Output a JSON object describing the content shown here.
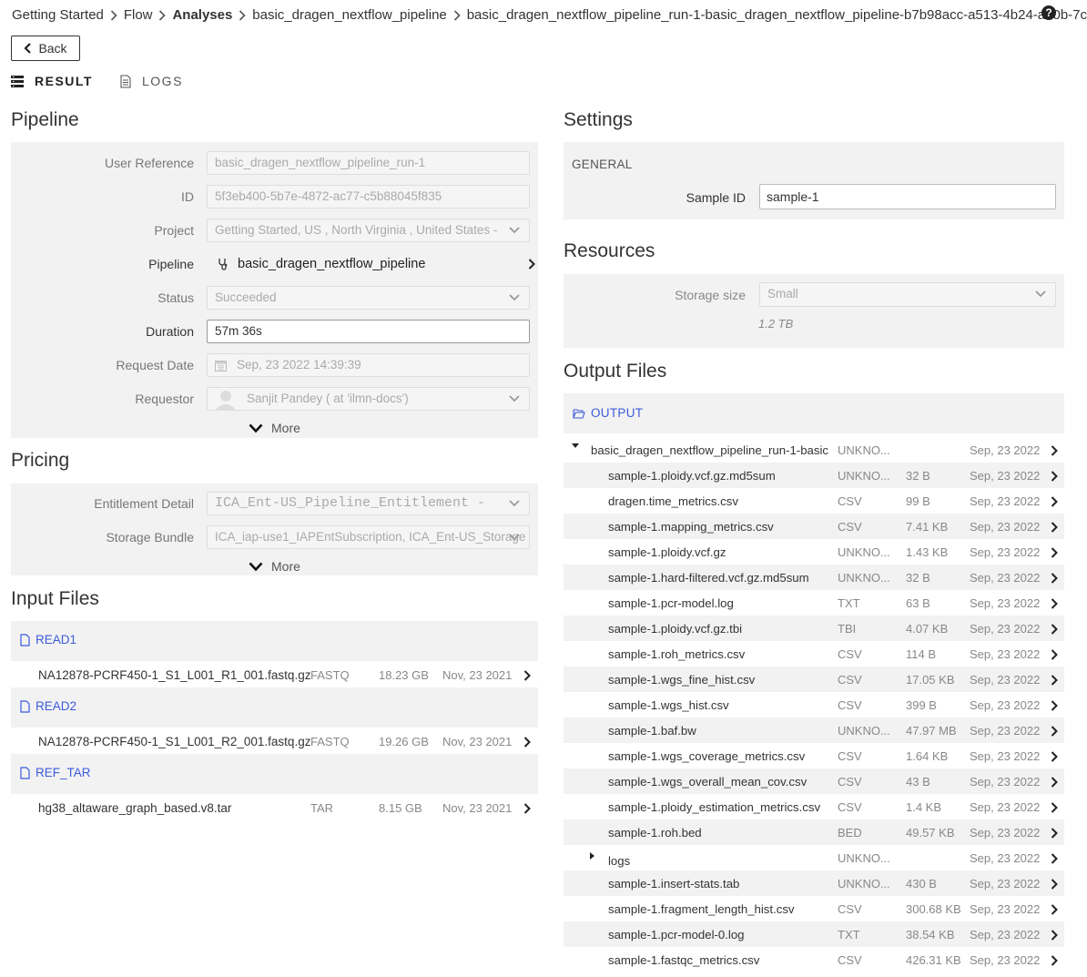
{
  "breadcrumb": [
    {
      "label": "Getting Started",
      "bold": false
    },
    {
      "label": "Flow",
      "bold": false
    },
    {
      "label": "Analyses",
      "bold": true
    },
    {
      "label": "basic_dragen_nextflow_pipeline",
      "bold": false
    },
    {
      "label": "basic_dragen_nextflow_pipeline_run-1-basic_dragen_nextflow_pipeline-b7b98acc-a513-4b24-a70b-7c",
      "bold": false
    }
  ],
  "help_icon_glyph": "?",
  "back_label": "Back",
  "tabs": {
    "result": "RESULT",
    "logs": "LOGS"
  },
  "pipeline_section": {
    "title": "Pipeline",
    "fields": {
      "user_reference": {
        "label": "User Reference",
        "value": "basic_dragen_nextflow_pipeline_run-1"
      },
      "id": {
        "label": "ID",
        "value": "5f3eb400-5b7e-4872-ac77-c5b88045f835"
      },
      "project": {
        "label": "Project",
        "value": "Getting Started, US , North Virginia , United States -"
      },
      "pipeline": {
        "label": "Pipeline",
        "value": "basic_dragen_nextflow_pipeline"
      },
      "status": {
        "label": "Status",
        "value": "Succeeded"
      },
      "duration": {
        "label": "Duration",
        "value": "57m 36s"
      },
      "request_date": {
        "label": "Request Date",
        "value": "Sep, 23 2022 14:39:39"
      },
      "requestor": {
        "label": "Requestor",
        "value": "Sanjit Pandey ( at 'ilmn-docs')"
      }
    },
    "more_label": "More"
  },
  "pricing_section": {
    "title": "Pricing",
    "entitlement_detail": {
      "label": "Entitlement Detail",
      "value": "ICA_Ent-US_Pipeline_Entitlement -"
    },
    "storage_bundle": {
      "label": "Storage Bundle",
      "value": "ICA_iap-use1_IAPEntSubscription, ICA_Ent-US_Storage"
    },
    "more_label": "More"
  },
  "input_files": {
    "title": "Input Files",
    "groups": [
      {
        "label": "READ1",
        "file": {
          "name": "NA12878-PCRF450-1_S1_L001_R1_001.fastq.gz",
          "type": "FASTQ",
          "size": "18.23 GB",
          "date": "Nov, 23 2021"
        }
      },
      {
        "label": "READ2",
        "file": {
          "name": "NA12878-PCRF450-1_S1_L001_R2_001.fastq.gz",
          "type": "FASTQ",
          "size": "19.26 GB",
          "date": "Nov, 23 2021"
        }
      },
      {
        "label": "REF_TAR",
        "file": {
          "name": "hg38_altaware_graph_based.v8.tar",
          "type": "TAR",
          "size": "8.15 GB",
          "date": "Nov, 23 2021"
        }
      }
    ]
  },
  "settings": {
    "title": "Settings",
    "group": "GENERAL",
    "sample_id": {
      "label": "Sample ID",
      "value": "sample-1"
    }
  },
  "resources": {
    "title": "Resources",
    "storage_size": {
      "label": "Storage size",
      "value": "Small"
    },
    "storage_note": "1.2 TB"
  },
  "output_files": {
    "title": "Output Files",
    "group": "OUTPUT",
    "root_folder": {
      "name": "basic_dragen_nextflow_pipeline_run-1-basic",
      "type": "UNKNO...",
      "size": "",
      "date": "Sep, 23 2022"
    },
    "files": [
      {
        "name": "sample-1.ploidy.vcf.gz.md5sum",
        "type": "UNKNO...",
        "size": "32 B",
        "date": "Sep, 23 2022"
      },
      {
        "name": "dragen.time_metrics.csv",
        "type": "CSV",
        "size": "99 B",
        "date": "Sep, 23 2022"
      },
      {
        "name": "sample-1.mapping_metrics.csv",
        "type": "CSV",
        "size": "7.41 KB",
        "date": "Sep, 23 2022"
      },
      {
        "name": "sample-1.ploidy.vcf.gz",
        "type": "UNKNO...",
        "size": "1.43 KB",
        "date": "Sep, 23 2022"
      },
      {
        "name": "sample-1.hard-filtered.vcf.gz.md5sum",
        "type": "UNKNO...",
        "size": "32 B",
        "date": "Sep, 23 2022"
      },
      {
        "name": "sample-1.pcr-model.log",
        "type": "TXT",
        "size": "63 B",
        "date": "Sep, 23 2022"
      },
      {
        "name": "sample-1.ploidy.vcf.gz.tbi",
        "type": "TBI",
        "size": "4.07 KB",
        "date": "Sep, 23 2022"
      },
      {
        "name": "sample-1.roh_metrics.csv",
        "type": "CSV",
        "size": "114 B",
        "date": "Sep, 23 2022"
      },
      {
        "name": "sample-1.wgs_fine_hist.csv",
        "type": "CSV",
        "size": "17.05 KB",
        "date": "Sep, 23 2022"
      },
      {
        "name": "sample-1.wgs_hist.csv",
        "type": "CSV",
        "size": "399 B",
        "date": "Sep, 23 2022"
      },
      {
        "name": "sample-1.baf.bw",
        "type": "UNKNO...",
        "size": "47.97 MB",
        "date": "Sep, 23 2022"
      },
      {
        "name": "sample-1.wgs_coverage_metrics.csv",
        "type": "CSV",
        "size": "1.64 KB",
        "date": "Sep, 23 2022"
      },
      {
        "name": "sample-1.wgs_overall_mean_cov.csv",
        "type": "CSV",
        "size": "43 B",
        "date": "Sep, 23 2022"
      },
      {
        "name": "sample-1.ploidy_estimation_metrics.csv",
        "type": "CSV",
        "size": "1.4 KB",
        "date": "Sep, 23 2022"
      },
      {
        "name": "sample-1.roh.bed",
        "type": "BED",
        "size": "49.57 KB",
        "date": "Sep, 23 2022"
      },
      {
        "name": "logs",
        "type": "UNKNO...",
        "size": "",
        "date": "Sep, 23 2022",
        "folder": true
      },
      {
        "name": "sample-1.insert-stats.tab",
        "type": "UNKNO...",
        "size": "430 B",
        "date": "Sep, 23 2022"
      },
      {
        "name": "sample-1.fragment_length_hist.csv",
        "type": "CSV",
        "size": "300.68 KB",
        "date": "Sep, 23 2022"
      },
      {
        "name": "sample-1.pcr-model-0.log",
        "type": "TXT",
        "size": "38.54 KB",
        "date": "Sep, 23 2022"
      },
      {
        "name": "sample-1.fastqc_metrics.csv",
        "type": "CSV",
        "size": "426.31 KB",
        "date": "Sep, 23 2022"
      }
    ]
  },
  "colors": {
    "link": "#3b5bdb",
    "panel_bg": "#f2f2f2",
    "text": "#333333",
    "muted": "#888888"
  }
}
